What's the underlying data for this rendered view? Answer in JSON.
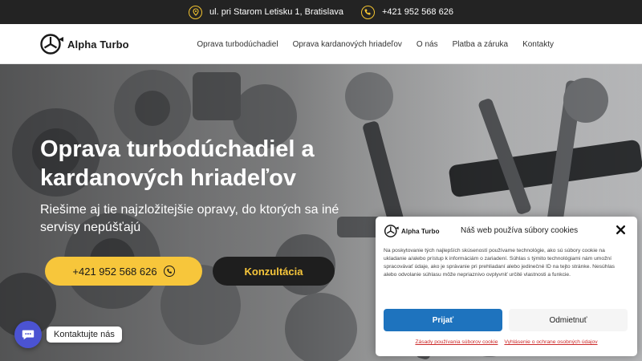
{
  "topbar": {
    "address": "ul. pri Starom Letisku 1, Bratislava",
    "phone": "+421 952 568 626",
    "icons": [
      "location-icon",
      "phone-icon"
    ],
    "accent": "#f4c430"
  },
  "header": {
    "logo_text": "Alpha Turbo",
    "nav": [
      "Oprava turbodúchadiel",
      "Oprava kardanových hriadeľov",
      "O nás",
      "Platba a záruka",
      "Kontakty"
    ]
  },
  "hero": {
    "title": "Oprava turbodúchadiel a kardanových hriadeľov",
    "subtitle": "Riešime aj tie najzložitejšie opravy, do ktorých sa iné servisy nepúšťajú",
    "phone_button": "+421 952 568 626",
    "consult_button": "Konzultácia",
    "colors": {
      "phone_button": "#f7c63b",
      "consult_button": "#1e1e1e"
    }
  },
  "chat": {
    "label": "Kontaktujte nás",
    "color": "#4b53d2"
  },
  "cookie": {
    "logo_text": "Alpha Turbo",
    "title": "Náš web používa súbory cookies",
    "text": "Na poskytovanie tých najlepších skúseností používame technológie, ako sú súbory cookie na ukladanie a/alebo prístup k informáciám o zariadení. Súhlas s týmito technológiami nám umožní spracovávať údaje, ako je správanie pri prehliadaní alebo jedinečné ID na tejto stránke. Nesúhlas alebo odvolanie súhlasu môže nepriaznivo ovplyvniť určité vlastnosti a funkcie.",
    "accept": "Prijať",
    "deny": "Odmietnuť",
    "link_cookies": "Zásady používania súborov cookie",
    "link_privacy": "Vyhlásenie o ochrane osobných údajov",
    "colors": {
      "accept": "#1e73be",
      "links": "#cc2a2a"
    }
  }
}
